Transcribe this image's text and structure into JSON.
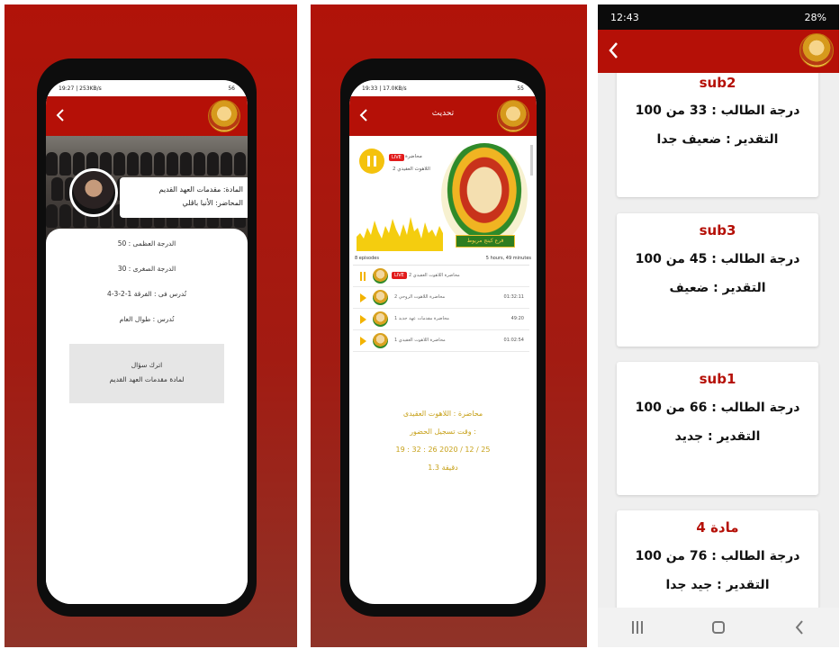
{
  "screen1": {
    "status_bar": {
      "time": "19:27 | 253KB/s",
      "battery": "56"
    },
    "title_line1": "المادة: مقدمات العهد القديم",
    "title_line2": "المحاضر: الأنبا باڤلي",
    "info": [
      "الدرجة العظمى : 50",
      "الدرجة الصغرى : 30",
      "تُدرس فى : الفرقة 1-2-3-4",
      "تُدرس : طوال العام"
    ],
    "question_line1": "اترك سؤال",
    "question_line2": "لمادة مقدمات العهد القديم"
  },
  "screen2": {
    "status_bar": {
      "time": "19:33 | 17.0KB/s",
      "battery": "55"
    },
    "toolbar_title": "تحديث",
    "player": {
      "live": "LIVE",
      "label": "محاضرة",
      "title": "اللاهوت العقيدي 2"
    },
    "medal_text": "فرع كينج مريوط",
    "episodes_count": "8 episodes",
    "total_duration": "5 hours, 49 minutes",
    "episodes": [
      {
        "title": "محاضرة اللاهوت العقيدي 2",
        "duration": "",
        "live": "LIVE",
        "playing": true
      },
      {
        "title": "محاضرة اللاهوت الروحي 2",
        "duration": "01:32:11",
        "live": "",
        "playing": false
      },
      {
        "title": "محاضرة مقدمات عهد جديد 1",
        "duration": "49:20",
        "live": "",
        "playing": false
      },
      {
        "title": "محاضرة اللاهوت العقيدي 1",
        "duration": "01:02:54",
        "live": "",
        "playing": false
      }
    ],
    "lecture_line1": "محاضرة : اللاهوت العقيدى",
    "lecture_line2": "وقت تسجيل الحضور :",
    "lecture_line3": "19 : 32 : 26  2020 / 12 / 25",
    "lecture_line4": "1.3 دقيقة"
  },
  "screen3": {
    "status_bar": {
      "time": "12:43",
      "battery": "28%"
    },
    "cards": [
      {
        "subject": "sub2",
        "grade": "درجة الطالب : 33 من 100",
        "rating": "التقدير : ضعيف جدا"
      },
      {
        "subject": "sub3",
        "grade": "درجة الطالب : 45 من 100",
        "rating": "التقدير : ضعيف"
      },
      {
        "subject": "sub1",
        "grade": "درجة الطالب : 66 من 100",
        "rating": "التقدير : جديد"
      },
      {
        "subject": "مادة 4",
        "grade": "درجة الطالب : 76 من 100",
        "rating": "التقدير : جيد جدا"
      }
    ]
  },
  "colors": {
    "brand_red": "#b51007",
    "accent_gold": "#c7a11a",
    "play_yellow": "#f3b300"
  }
}
